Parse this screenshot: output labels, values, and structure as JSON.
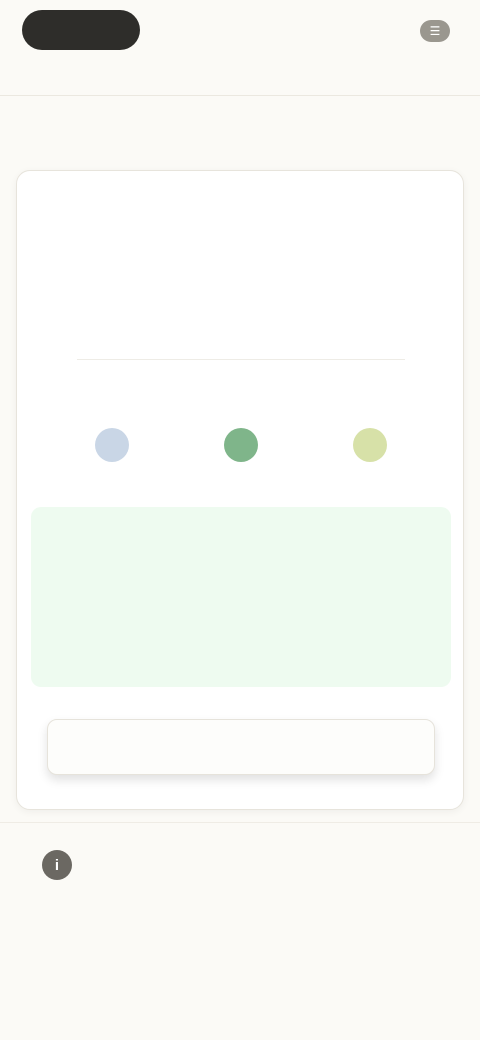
{
  "header": {
    "logo_label": "",
    "action_link": "",
    "action_icon": "menu-icon"
  },
  "section": {
    "title": ""
  },
  "stats": [
    {
      "value": "",
      "label": ""
    },
    {
      "value": "",
      "label": ""
    },
    {
      "value": "",
      "label": ""
    }
  ],
  "summary": {
    "text": ""
  },
  "metrics": [
    {
      "label": "",
      "color": "#c9d6e6",
      "caption": ""
    },
    {
      "label": "",
      "color": "#7fb58a",
      "caption": ""
    },
    {
      "label": "",
      "color": "#d7e1a8",
      "caption": ""
    }
  ],
  "highlight": {
    "top": "",
    "main": "",
    "bottom": ""
  },
  "cta": {
    "label": ""
  },
  "note": {
    "icon": "info-icon",
    "text": ""
  },
  "colors": {
    "background": "#fbfaf6",
    "card": "#ffffff",
    "highlight_bg": "#eefbf0",
    "logo_bg": "#2e2d2a"
  }
}
